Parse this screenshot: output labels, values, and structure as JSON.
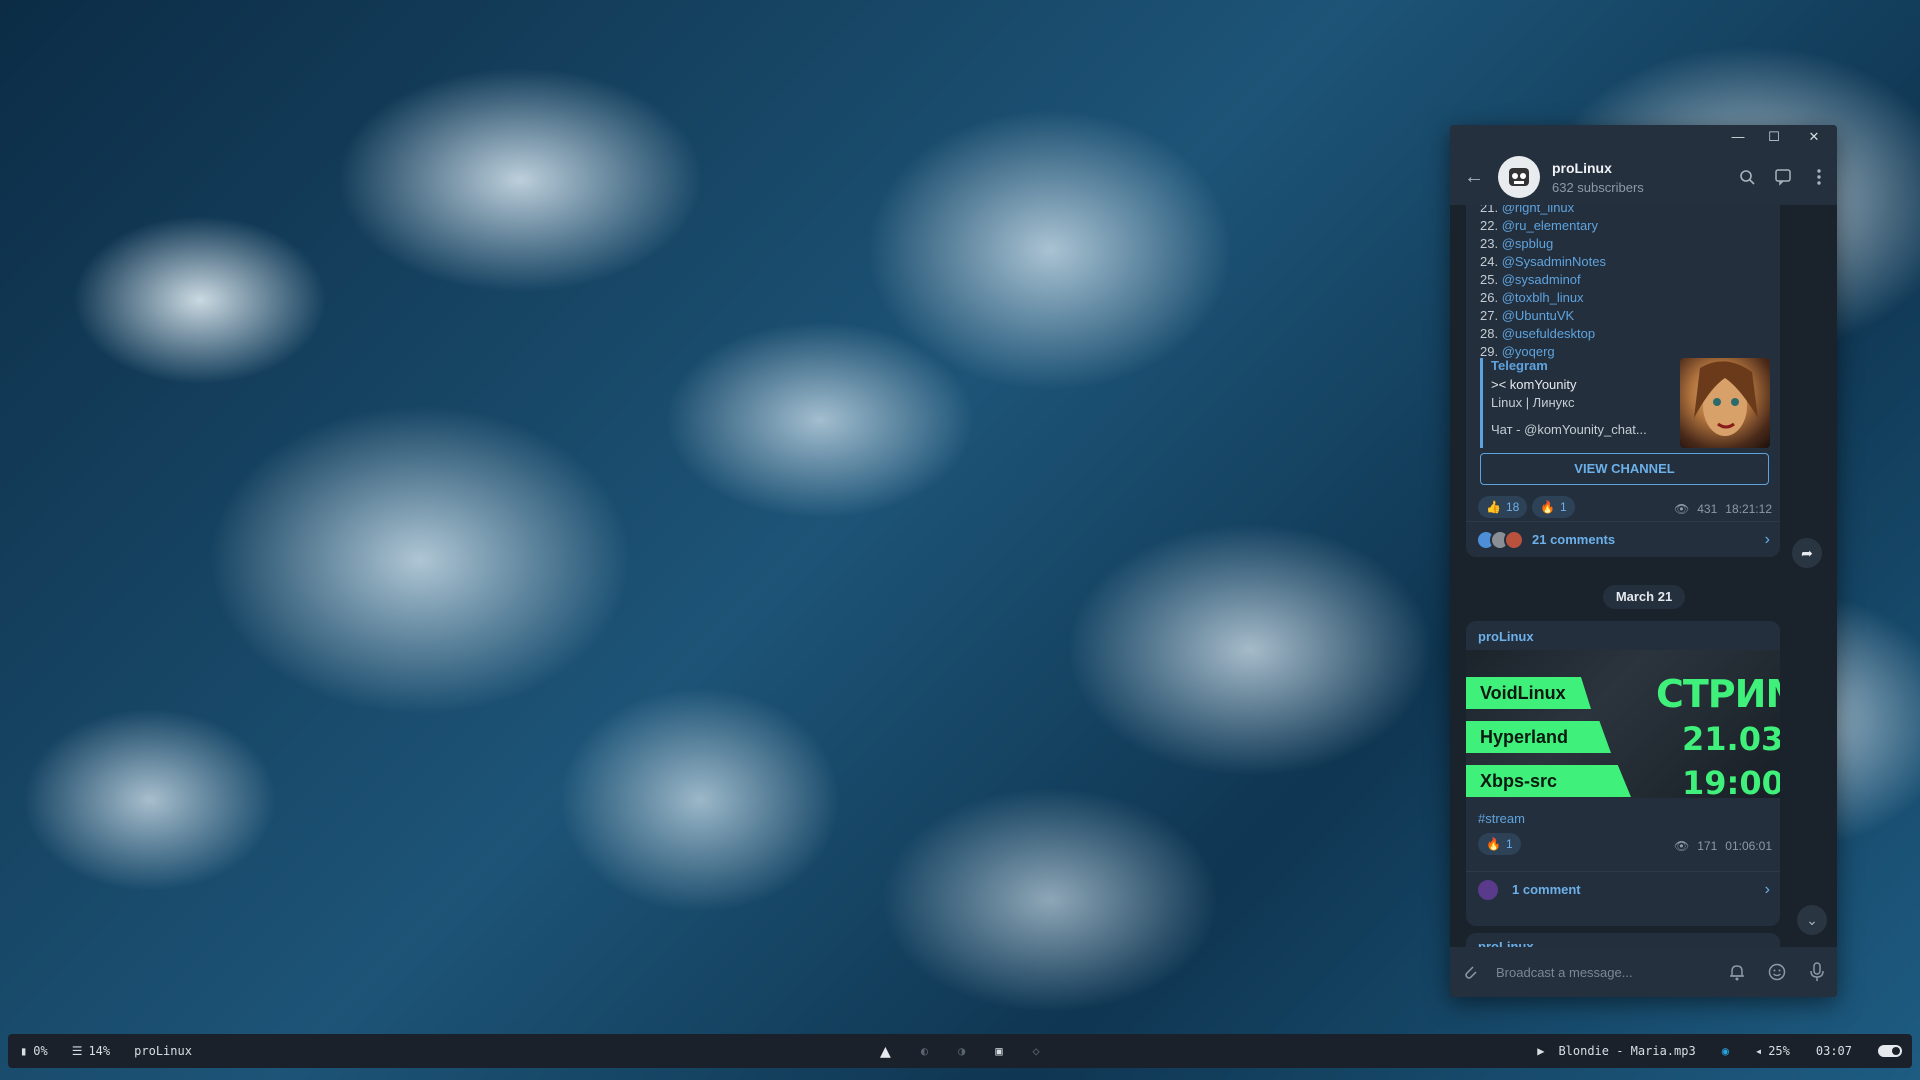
{
  "window": {
    "title": "proLinux",
    "subtitle": "632 subscribers"
  },
  "post1": {
    "list": [
      {
        "num": "21.",
        "handle": "@right_linux"
      },
      {
        "num": "22.",
        "handle": "@ru_elementary"
      },
      {
        "num": "23.",
        "handle": "@spblug"
      },
      {
        "num": "24.",
        "handle": "@SysadminNotes"
      },
      {
        "num": "25.",
        "handle": "@sysadminof"
      },
      {
        "num": "26.",
        "handle": "@toxblh_linux"
      },
      {
        "num": "27.",
        "handle": "@UbuntuVK"
      },
      {
        "num": "28.",
        "handle": "@usefuldesktop"
      },
      {
        "num": "29.",
        "handle": "@yoqerg"
      }
    ],
    "preview": {
      "site": "Telegram",
      "title": "><  komYounity",
      "desc": "Linux | Линукс",
      "desc2": "Чат - @komYounity_chat..."
    },
    "view_button": "VIEW CHANNEL",
    "reactions": [
      {
        "emoji": "👍",
        "count": "18"
      },
      {
        "emoji": "🔥",
        "count": "1"
      }
    ],
    "views": "431",
    "time": "18:21:12",
    "comments": "21 comments"
  },
  "date_separator": "March 21",
  "post2": {
    "author": "proLinux",
    "image": {
      "tags": [
        "VoidLinux",
        "Hyperland",
        "Xbps-src"
      ],
      "headline": "СТРИМ",
      "date": "21.03",
      "time": "19:00"
    },
    "hashtag": "#stream",
    "reactions": [
      {
        "emoji": "🔥",
        "count": "1"
      }
    ],
    "views": "171",
    "time": "01:06:01",
    "comments": "1 comment"
  },
  "post3": {
    "author": "proLinux"
  },
  "composer": {
    "placeholder": "Broadcast a message..."
  },
  "taskbar": {
    "cpu": "0%",
    "mem": "14%",
    "active_window": "proLinux",
    "music": "Blondie - Maria.mp3",
    "volume": "25%",
    "clock": "03:07"
  },
  "colors": {
    "accent": "#5fa3de",
    "stream_green": "#3ff07a",
    "window_bg": "#1f2630"
  }
}
